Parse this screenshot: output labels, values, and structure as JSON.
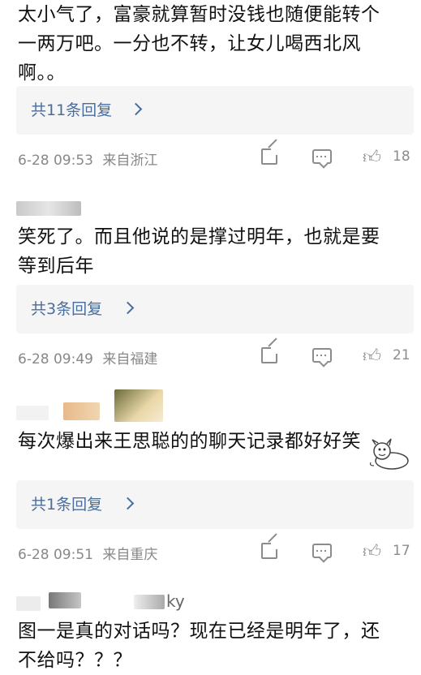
{
  "comments": [
    {
      "text_lines": [
        "太小气了，富豪就算暂时没钱也随便能转个",
        "一两万吧。一分也不转，让女儿喝西北风",
        "啊。。"
      ],
      "replies": "共11条回复",
      "date": "6-28 09:53",
      "location": "来自浙江",
      "likes": "18"
    },
    {
      "username": "",
      "text_lines": [
        "笑死了。而且他说的是撑过明年，也就是要",
        "等到后年"
      ],
      "replies": "共3条回复",
      "date": "6-28 09:49",
      "location": "来自福建",
      "likes": "21"
    },
    {
      "username": "",
      "text_lines": [
        "每次爆出来王思聪的的聊天记录都好好笑"
      ],
      "replies": "共1条回复",
      "date": "6-28 09:51",
      "location": "来自重庆",
      "likes": "17"
    },
    {
      "username_suffix": "ky",
      "text_lines": [
        "图一是真的对话吗？现在已经是明年了，还",
        "不给吗？？？"
      ]
    }
  ],
  "icons": {
    "share": "share-icon",
    "comment": "comment-icon",
    "like": "thumbs-up-icon"
  }
}
